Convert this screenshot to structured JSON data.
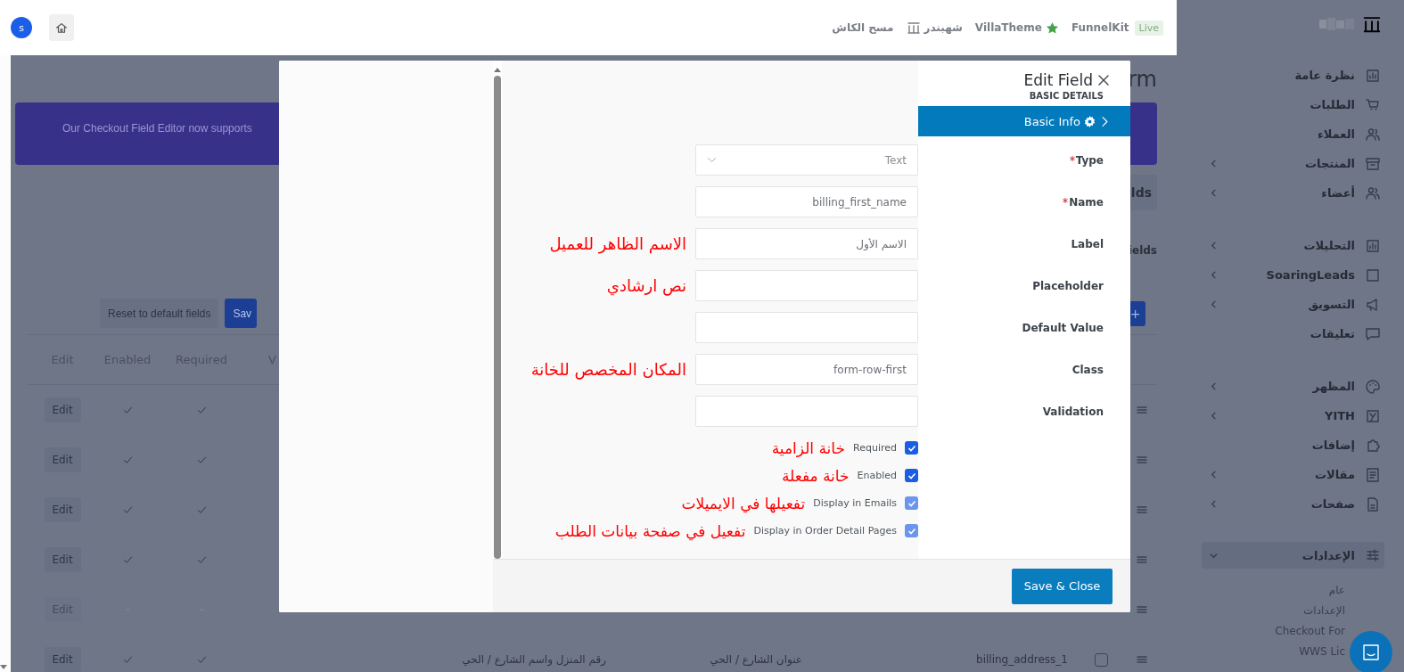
{
  "top_bar": {
    "avatar": "s",
    "links": [
      {
        "text": "FunnelKit",
        "kind": "plain"
      },
      {
        "text": "VillaTheme",
        "kind": "star"
      },
      {
        "text": "شهبندر",
        "kind": "logo"
      },
      {
        "text": "مسح الكاش",
        "kind": "plain"
      }
    ],
    "badge": "Live"
  },
  "page": {
    "title": "rm",
    "banner": "Our Checkout Field Editor now supports",
    "tab": "lds",
    "section": "ields",
    "buttons": [
      {
        "label": "Sav",
        "kind": "primary"
      },
      {
        "label": "Reset to default fields",
        "kind": "secondary"
      }
    ],
    "add_button": "+",
    "table": {
      "columns": [
        "V",
        "Required",
        "Enabled",
        "Edit"
      ],
      "rows": [
        {
          "edit": "Edit",
          "enabled": true,
          "required": true
        },
        {
          "edit": "Edit",
          "enabled": true,
          "required": true
        },
        {
          "edit": "Edit",
          "enabled": true,
          "required": true
        },
        {
          "edit": "Edit",
          "enabled": true,
          "required": true
        },
        {
          "edit": "Edit",
          "enabled": false,
          "required": false
        },
        {
          "edit": "Edit",
          "enabled": true,
          "required": true,
          "cells": [
            "billing_address_1",
            "عنوان الشارع / الحي",
            "رقم المنزل واسم الشارع / الحي"
          ],
          "selected": false
        }
      ]
    }
  },
  "modal": {
    "title": "Edit Field",
    "section": "BASIC DETAILS",
    "tabs": [
      {
        "label": "Basic Info",
        "selected": true
      }
    ],
    "fields": [
      {
        "label": "Type",
        "required": true,
        "kind": "select",
        "value": "Text"
      },
      {
        "label": "Name",
        "required": true,
        "kind": "text",
        "value": "billing_first_name"
      },
      {
        "label": "Label",
        "required": false,
        "kind": "text",
        "value": "الاسم الأول",
        "note": "الاسم الظاهر للعميل"
      },
      {
        "label": "Placeholder",
        "required": false,
        "kind": "text",
        "note": "نص ارشادي"
      },
      {
        "label": "Default Value",
        "required": false,
        "kind": "text"
      },
      {
        "label": "Class",
        "required": false,
        "kind": "text",
        "value": "form-row-first",
        "note": "المكان المخصص للخانة"
      },
      {
        "label": "Validation",
        "required": false,
        "kind": "text"
      }
    ],
    "checkboxes": [
      {
        "label": "Required",
        "checked": true,
        "disabled": false,
        "note": "خانة الزامية"
      },
      {
        "label": "Enabled",
        "checked": true,
        "disabled": false,
        "note": "خانة مفعلة"
      },
      {
        "label": "Display in Emails",
        "checked": true,
        "disabled": true,
        "note": "تفعيلها في الايميلات"
      },
      {
        "label": "Display in Order Detail Pages",
        "checked": true,
        "disabled": true,
        "note": "تفعيل في صفحة بيانات الطلب"
      }
    ],
    "save_button": "Save & Close"
  },
  "sidebar": {
    "groups": [
      [
        {
          "label": "نظرة عامة",
          "has_submenu": false,
          "selected": false
        },
        {
          "label": "الطلبات",
          "has_submenu": false,
          "selected": false
        },
        {
          "label": "العملاء",
          "has_submenu": false,
          "selected": false
        },
        {
          "label": "المنتجات",
          "has_submenu": true,
          "selected": false
        },
        {
          "label": "أعضاء",
          "has_submenu": true,
          "selected": false
        }
      ],
      [
        {
          "label": "التحليلات",
          "has_submenu": true,
          "selected": false
        },
        {
          "label": "SoaringLeads",
          "has_submenu": true,
          "selected": false
        },
        {
          "label": "التسويق",
          "has_submenu": true,
          "selected": false
        },
        {
          "label": "تعليقات",
          "has_submenu": false,
          "selected": false
        }
      ],
      [
        {
          "label": "المظهر",
          "has_submenu": true,
          "selected": false
        },
        {
          "label": "YITH",
          "has_submenu": true,
          "selected": false
        },
        {
          "label": "إضافات",
          "has_submenu": false,
          "selected": false
        },
        {
          "label": "مقالات",
          "has_submenu": true,
          "selected": false
        },
        {
          "label": "صفحات",
          "has_submenu": true,
          "selected": false
        }
      ],
      [
        {
          "label": "الإعدادات",
          "has_submenu": true,
          "selected": true,
          "expanded": true,
          "children": [
            {
              "label": "عام"
            },
            {
              "label": "الإعدادات"
            },
            {
              "label": "Checkout For"
            },
            {
              "label": "WWS Lic"
            }
          ]
        }
      ]
    ]
  }
}
